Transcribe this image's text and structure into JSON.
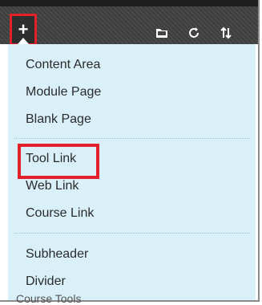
{
  "toolbar": {
    "add_glyph": "+",
    "icons": [
      "folder-icon",
      "refresh-icon",
      "sort-icon"
    ]
  },
  "menu": {
    "group1": [
      "Content Area",
      "Module Page",
      "Blank Page"
    ],
    "group2": [
      "Tool Link",
      "Web Link",
      "Course Link"
    ],
    "group3": [
      "Subheader",
      "Divider"
    ]
  },
  "below_text": "Course Tools",
  "colors": {
    "menu_bg": "#d9f0f9",
    "highlight": "#e4202b",
    "toolbar_bg": "#444444"
  }
}
